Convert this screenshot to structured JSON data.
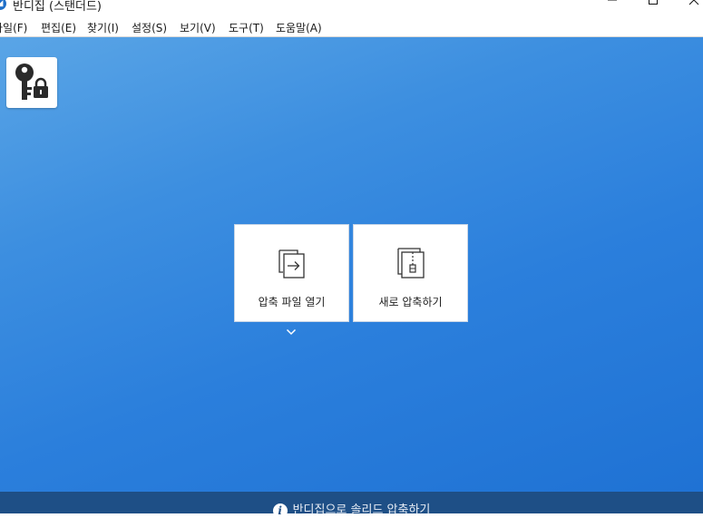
{
  "window": {
    "title": "반디집 (스탠더드)",
    "app_icon_glyph": "◢"
  },
  "menubar": {
    "items": [
      {
        "label": "파일(F)"
      },
      {
        "label": "편집(E)"
      },
      {
        "label": "찾기(I)"
      },
      {
        "label": "설정(S)"
      },
      {
        "label": "보기(V)"
      },
      {
        "label": "도구(T)"
      },
      {
        "label": "도움말(A)"
      }
    ]
  },
  "toolbar": {
    "lock_icon": "key-lock-icon"
  },
  "actions": {
    "open_archive": {
      "label": "압축 파일 열기",
      "icon": "open-archive-icon"
    },
    "new_archive": {
      "label": "새로 압축하기",
      "icon": "zip-file-icon"
    },
    "more_icon": "chevron-down-icon"
  },
  "statusbar": {
    "text": "반디집으로 솔리드 압축하기",
    "icon": "info-icon"
  },
  "colors": {
    "workspace_gradient_start": "#5aa5e6",
    "workspace_gradient_end": "#1f72d4",
    "statusbar_bg": "#1e4f86"
  }
}
